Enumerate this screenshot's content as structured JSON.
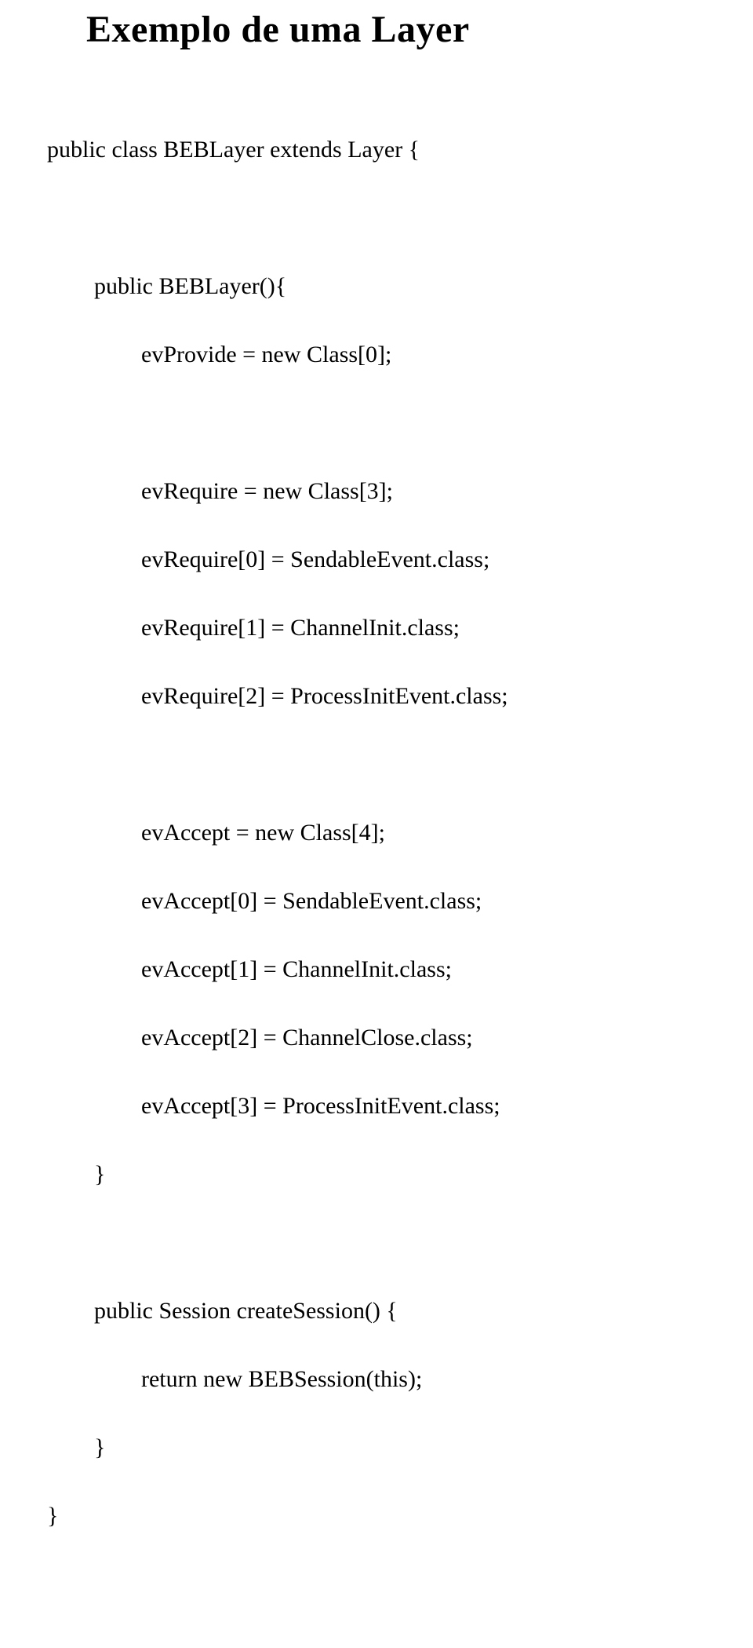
{
  "title": "Exemplo de uma Layer",
  "code": {
    "l01": "public class BEBLayer extends Layer {",
    "l02": "public BEBLayer(){",
    "l03": "evProvide = new Class[0];",
    "l04": "evRequire = new Class[3];",
    "l05": "evRequire[0] = SendableEvent.class;",
    "l06": "evRequire[1] = ChannelInit.class;",
    "l07": "evRequire[2] = ProcessInitEvent.class;",
    "l08": "evAccept = new Class[4];",
    "l09": "evAccept[0] = SendableEvent.class;",
    "l10": "evAccept[1] = ChannelInit.class;",
    "l11": "evAccept[2] = ChannelClose.class;",
    "l12": "evAccept[3] = ProcessInitEvent.class;",
    "l13": "}",
    "l14": "public Session createSession() {",
    "l15": "return new BEBSession(this);",
    "l16": "}",
    "l17": "}"
  }
}
